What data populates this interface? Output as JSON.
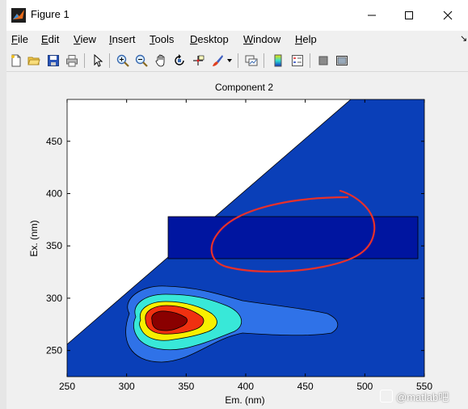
{
  "window": {
    "title": "Figure 1",
    "controls": {
      "minimize": "minimize",
      "maximize": "maximize",
      "close": "close"
    }
  },
  "menu": {
    "items": [
      "File",
      "Edit",
      "View",
      "Insert",
      "Tools",
      "Desktop",
      "Window",
      "Help"
    ],
    "underline": [
      "F",
      "E",
      "V",
      "I",
      "T",
      "D",
      "W",
      "H"
    ]
  },
  "toolbar": {
    "icons": [
      "new-figure-icon",
      "open-icon",
      "save-icon",
      "print-icon",
      "pointer-icon",
      "zoom-in-icon",
      "zoom-out-icon",
      "pan-icon",
      "rotate-icon",
      "data-cursor-icon",
      "brush-icon",
      "brush-dropdown-icon",
      "link-plot-icon",
      "colorbar-icon",
      "legend-icon",
      "hide-tools-icon",
      "show-tools-icon"
    ]
  },
  "chart_data": {
    "type": "heatmap",
    "subtype": "filled-contour",
    "title": "Component 2",
    "xlabel": "Em. (nm)",
    "ylabel": "Ex. (nm)",
    "xlim": [
      250,
      550
    ],
    "ylim": [
      225,
      490
    ],
    "xticks": [
      250,
      300,
      350,
      400,
      450,
      500,
      550
    ],
    "yticks": [
      250,
      300,
      350,
      400,
      450
    ],
    "blank_region": "Em < Ex (upper-left triangle, not plotted)",
    "contour_levels": [
      {
        "level": "background",
        "color": "#0a3fb8"
      },
      {
        "level": "low",
        "color": "#2f72e8",
        "extent_x": [
          285,
          478
        ],
        "extent_y": [
          235,
          310
        ]
      },
      {
        "level": "mid-low",
        "color": "#38e8d8",
        "extent_x": [
          296,
          395
        ],
        "extent_y": [
          244,
          300
        ]
      },
      {
        "level": "mid",
        "color": "#f8f000",
        "extent_x": [
          303,
          375
        ],
        "extent_y": [
          250,
          292
        ]
      },
      {
        "level": "high",
        "color": "#f03010",
        "extent_x": [
          310,
          358
        ],
        "extent_y": [
          256,
          286
        ]
      },
      {
        "level": "peak",
        "color": "#8a0000",
        "extent_x": [
          316,
          345
        ],
        "extent_y": [
          260,
          280
        ],
        "peak": {
          "em": 330,
          "ex": 272
        }
      }
    ],
    "highlight_rect": {
      "x": [
        353,
        544
      ],
      "y": [
        333,
        375
      ],
      "color": "#001a8a"
    },
    "annotation": {
      "shape": "hand-drawn ellipse",
      "color": "#e8302a",
      "center": {
        "em": 420,
        "ex": 355
      }
    }
  },
  "watermark": {
    "text": "@matlab吧"
  }
}
